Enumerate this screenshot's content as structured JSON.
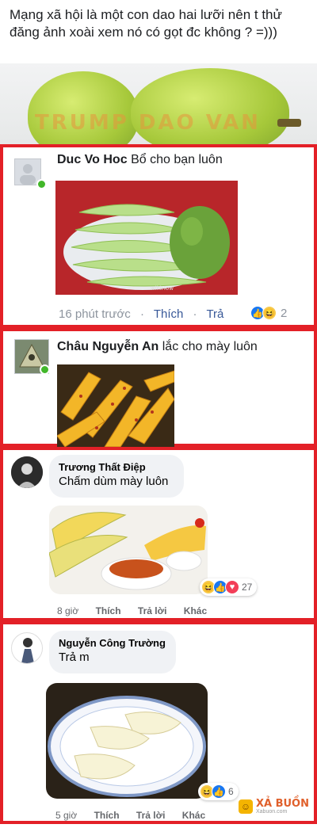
{
  "top_post": {
    "text": "Mạng xã hội là một con dao hai lưỡi nên t thử đăng ảnh xoài xem nó có gọt đc không ? =)))",
    "watermark": "TRUMP DAO VAN"
  },
  "comment1": {
    "author": "Duc Vo Hoc",
    "text": "Bổ cho bạn luôn",
    "time": "16 phút trước",
    "like": "Thích",
    "reply": "Trả",
    "reaction_count": "2",
    "photo_caption": "wikiHow"
  },
  "comment2": {
    "author": "Châu Nguyễn An",
    "text": "lắc cho mày luôn"
  },
  "comment3": {
    "author": "Trương Thất Điệp",
    "text": "Chấm dùm mày luôn",
    "time": "8 giờ",
    "like": "Thích",
    "reply": "Trả lời",
    "other": "Khác",
    "reaction_count": "27"
  },
  "comment4": {
    "author": "Nguyễn Công Trường",
    "text": "Trả m",
    "time": "5 giờ",
    "like": "Thích",
    "reply": "Trả lời",
    "other": "Khác",
    "reaction_count": "6"
  },
  "site_logo": {
    "brand": "XẢ BUỒN",
    "domain": "Xabuon.com"
  },
  "colors": {
    "frame": "#e32027",
    "online": "#42b72a",
    "link": "#385898"
  }
}
